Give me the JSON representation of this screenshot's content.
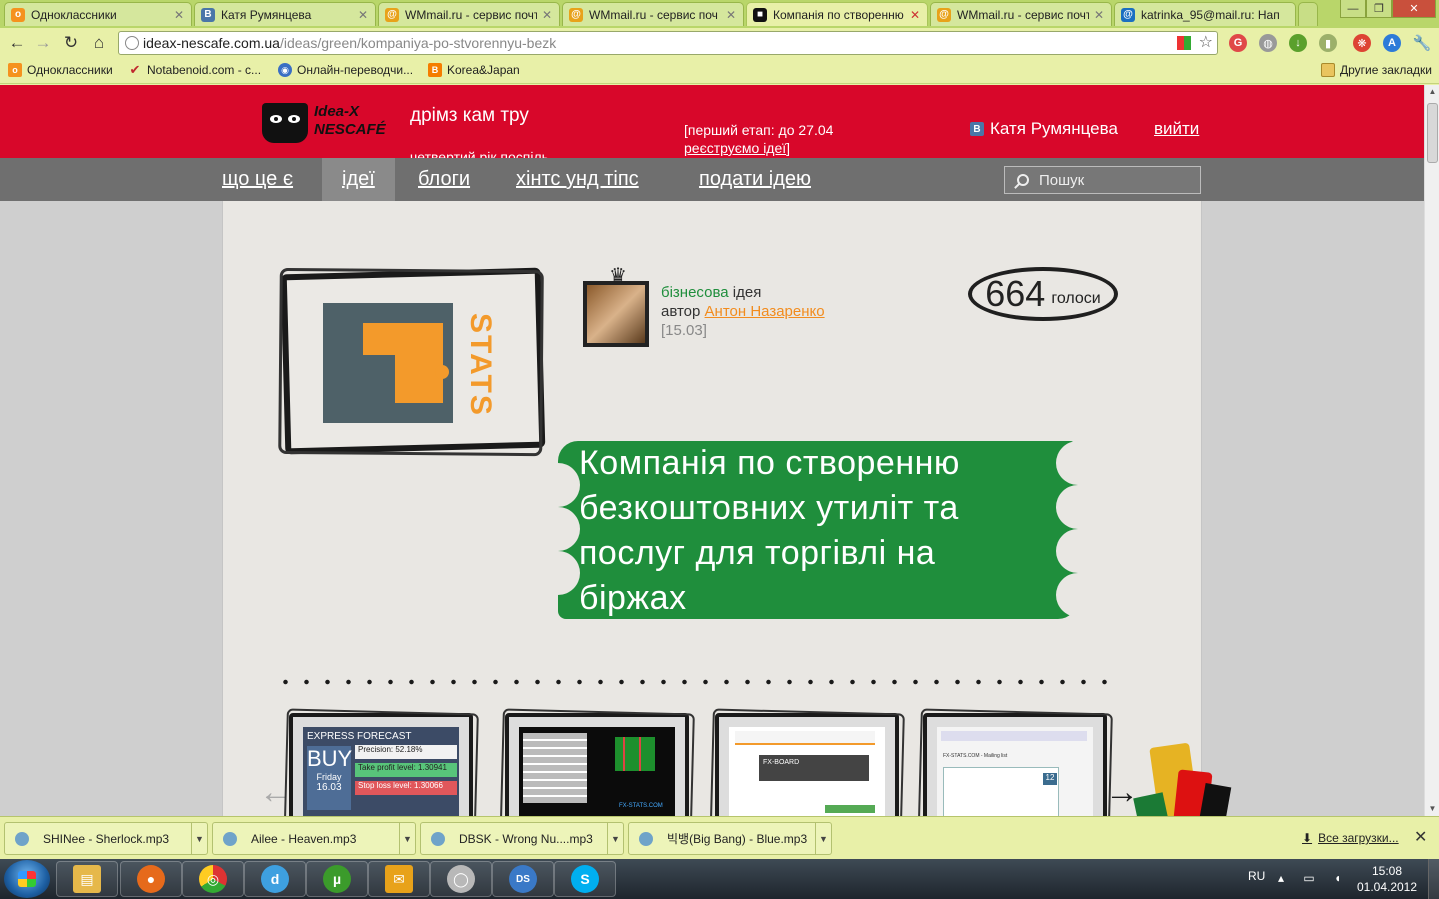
{
  "browser": {
    "tabs": [
      {
        "label": "Одноклассники",
        "favicon": "odnoklassniki-icon",
        "color": "#f5921e",
        "glyph": "о",
        "active": false
      },
      {
        "label": "Катя Румянцева",
        "favicon": "vk-icon",
        "color": "#4a76a8",
        "glyph": "В",
        "active": false
      },
      {
        "label": "WMmail.ru - сервис почт",
        "favicon": "wmmail-icon",
        "color": "#e8a21a",
        "glyph": "@",
        "active": false
      },
      {
        "label": "WMmail.ru - сервис поч",
        "favicon": "wmmail-icon",
        "color": "#e8a21a",
        "glyph": "@",
        "active": false
      },
      {
        "label": "Компанія по створенню",
        "favicon": "nescafe-icon",
        "color": "#111111",
        "glyph": "■",
        "active": true
      },
      {
        "label": "WMmail.ru - сервис почт",
        "favicon": "wmmail-icon",
        "color": "#e8a21a",
        "glyph": "@",
        "active": false
      },
      {
        "label": "katrinka_95@mail.ru: Нап",
        "favicon": "mailru-icon",
        "color": "#1b6fc1",
        "glyph": "@",
        "active": false
      }
    ],
    "address": {
      "host": "ideax-nescafe.com.ua",
      "path": "/ideas/green/kompaniya-po-stvorennyu-bezk"
    },
    "bookmarks": [
      {
        "label": "Одноклассники",
        "icon": "odnoklassniki-icon",
        "color": "#f5921e",
        "glyph": "о"
      },
      {
        "label": "Notabenoid.com - с...",
        "icon": "notabenoid-icon",
        "color": "#c0272d",
        "glyph": "✔"
      },
      {
        "label": "Онлайн-переводчи...",
        "icon": "globe-icon",
        "color": "#3a6fc4",
        "glyph": "◉"
      },
      {
        "label": "Korea&Japan",
        "icon": "blogger-icon",
        "color": "#f57d00",
        "glyph": "B"
      }
    ],
    "other_bookmarks": "Другие закладки"
  },
  "site": {
    "logo": {
      "line1": "Idea-X",
      "line2": "NESCAFÉ"
    },
    "title": "дрімз кам тру",
    "subtitle": "четвертий рік поспіль",
    "stage_note_1": "[перший етап: до 27.04",
    "stage_note_2": "реєструємо ідеї",
    "stage_note_3": "]",
    "user": {
      "name": "Катя Румянцева",
      "badge": "В"
    },
    "logout": "вийти",
    "nav": [
      {
        "label": "що це є",
        "active": false
      },
      {
        "label": "ідеї",
        "active": true
      },
      {
        "label": "блоги",
        "active": false
      },
      {
        "label": "хінтс унд тіпс",
        "active": false
      },
      {
        "label": "подати ідею",
        "active": false
      }
    ],
    "search_placeholder": "Пошук"
  },
  "idea": {
    "logo_text": "STATS",
    "category": "бізнесова",
    "category_suffix": "ідея",
    "author_prefix": "автор",
    "author": "Антон Назаренко",
    "date": "[15.03]",
    "votes": "664",
    "votes_label": "голоси",
    "title": "Компанія по створенню безкоштовних утиліт та послуг для торгівлі на біржах",
    "thumbnails": [
      {
        "name": "express-forecast-screenshot",
        "header": "EXPRESS FORECAST",
        "buy": "BUY",
        "day": "Friday",
        "date": "16.03",
        "rows": [
          "Precision: 52.18%",
          "Take profit level: 1.30941",
          "Stop loss level: 1.30066"
        ]
      },
      {
        "name": "trading-terminal-screenshot",
        "badge": "FX-STATS.COM"
      },
      {
        "name": "fx-board-screenshot",
        "badge": "FX-BOARD"
      },
      {
        "name": "mailing-list-screenshot",
        "badge": "FX-STATS.COM - Mailing list",
        "count": "12"
      }
    ]
  },
  "downloads": {
    "items": [
      {
        "label": "SHINee - Sherlock.mp3"
      },
      {
        "label": "Ailee - Heaven.mp3"
      },
      {
        "label": "DBSK - Wrong Nu....mp3"
      },
      {
        "label": "빅뱅(Big Bang) - Blue.mp3"
      }
    ],
    "all_label": "Все загрузки..."
  },
  "taskbar": {
    "apps": [
      {
        "name": "explorer-icon",
        "glyph": "▤",
        "color": "#e6b84a"
      },
      {
        "name": "firefox-icon",
        "glyph": "●",
        "color": "#e66a1b"
      },
      {
        "name": "chrome-icon",
        "glyph": "◎",
        "color": "#3a9a3a"
      },
      {
        "name": "d-app-icon",
        "glyph": "d",
        "color": "#3ea0e0"
      },
      {
        "name": "utorrent-icon",
        "glyph": "µ",
        "color": "#3b9b2b"
      },
      {
        "name": "mail-app-icon",
        "glyph": "✉",
        "color": "#e8a21a"
      },
      {
        "name": "media-player-icon",
        "glyph": "◯",
        "color": "#b8b8b8"
      },
      {
        "name": "ds-app-icon",
        "glyph": "DS",
        "color": "#3a79c7"
      },
      {
        "name": "skype-icon",
        "glyph": "S",
        "color": "#00aff0"
      }
    ],
    "lang": "RU",
    "time": "15:08",
    "date": "01.04.2012"
  }
}
